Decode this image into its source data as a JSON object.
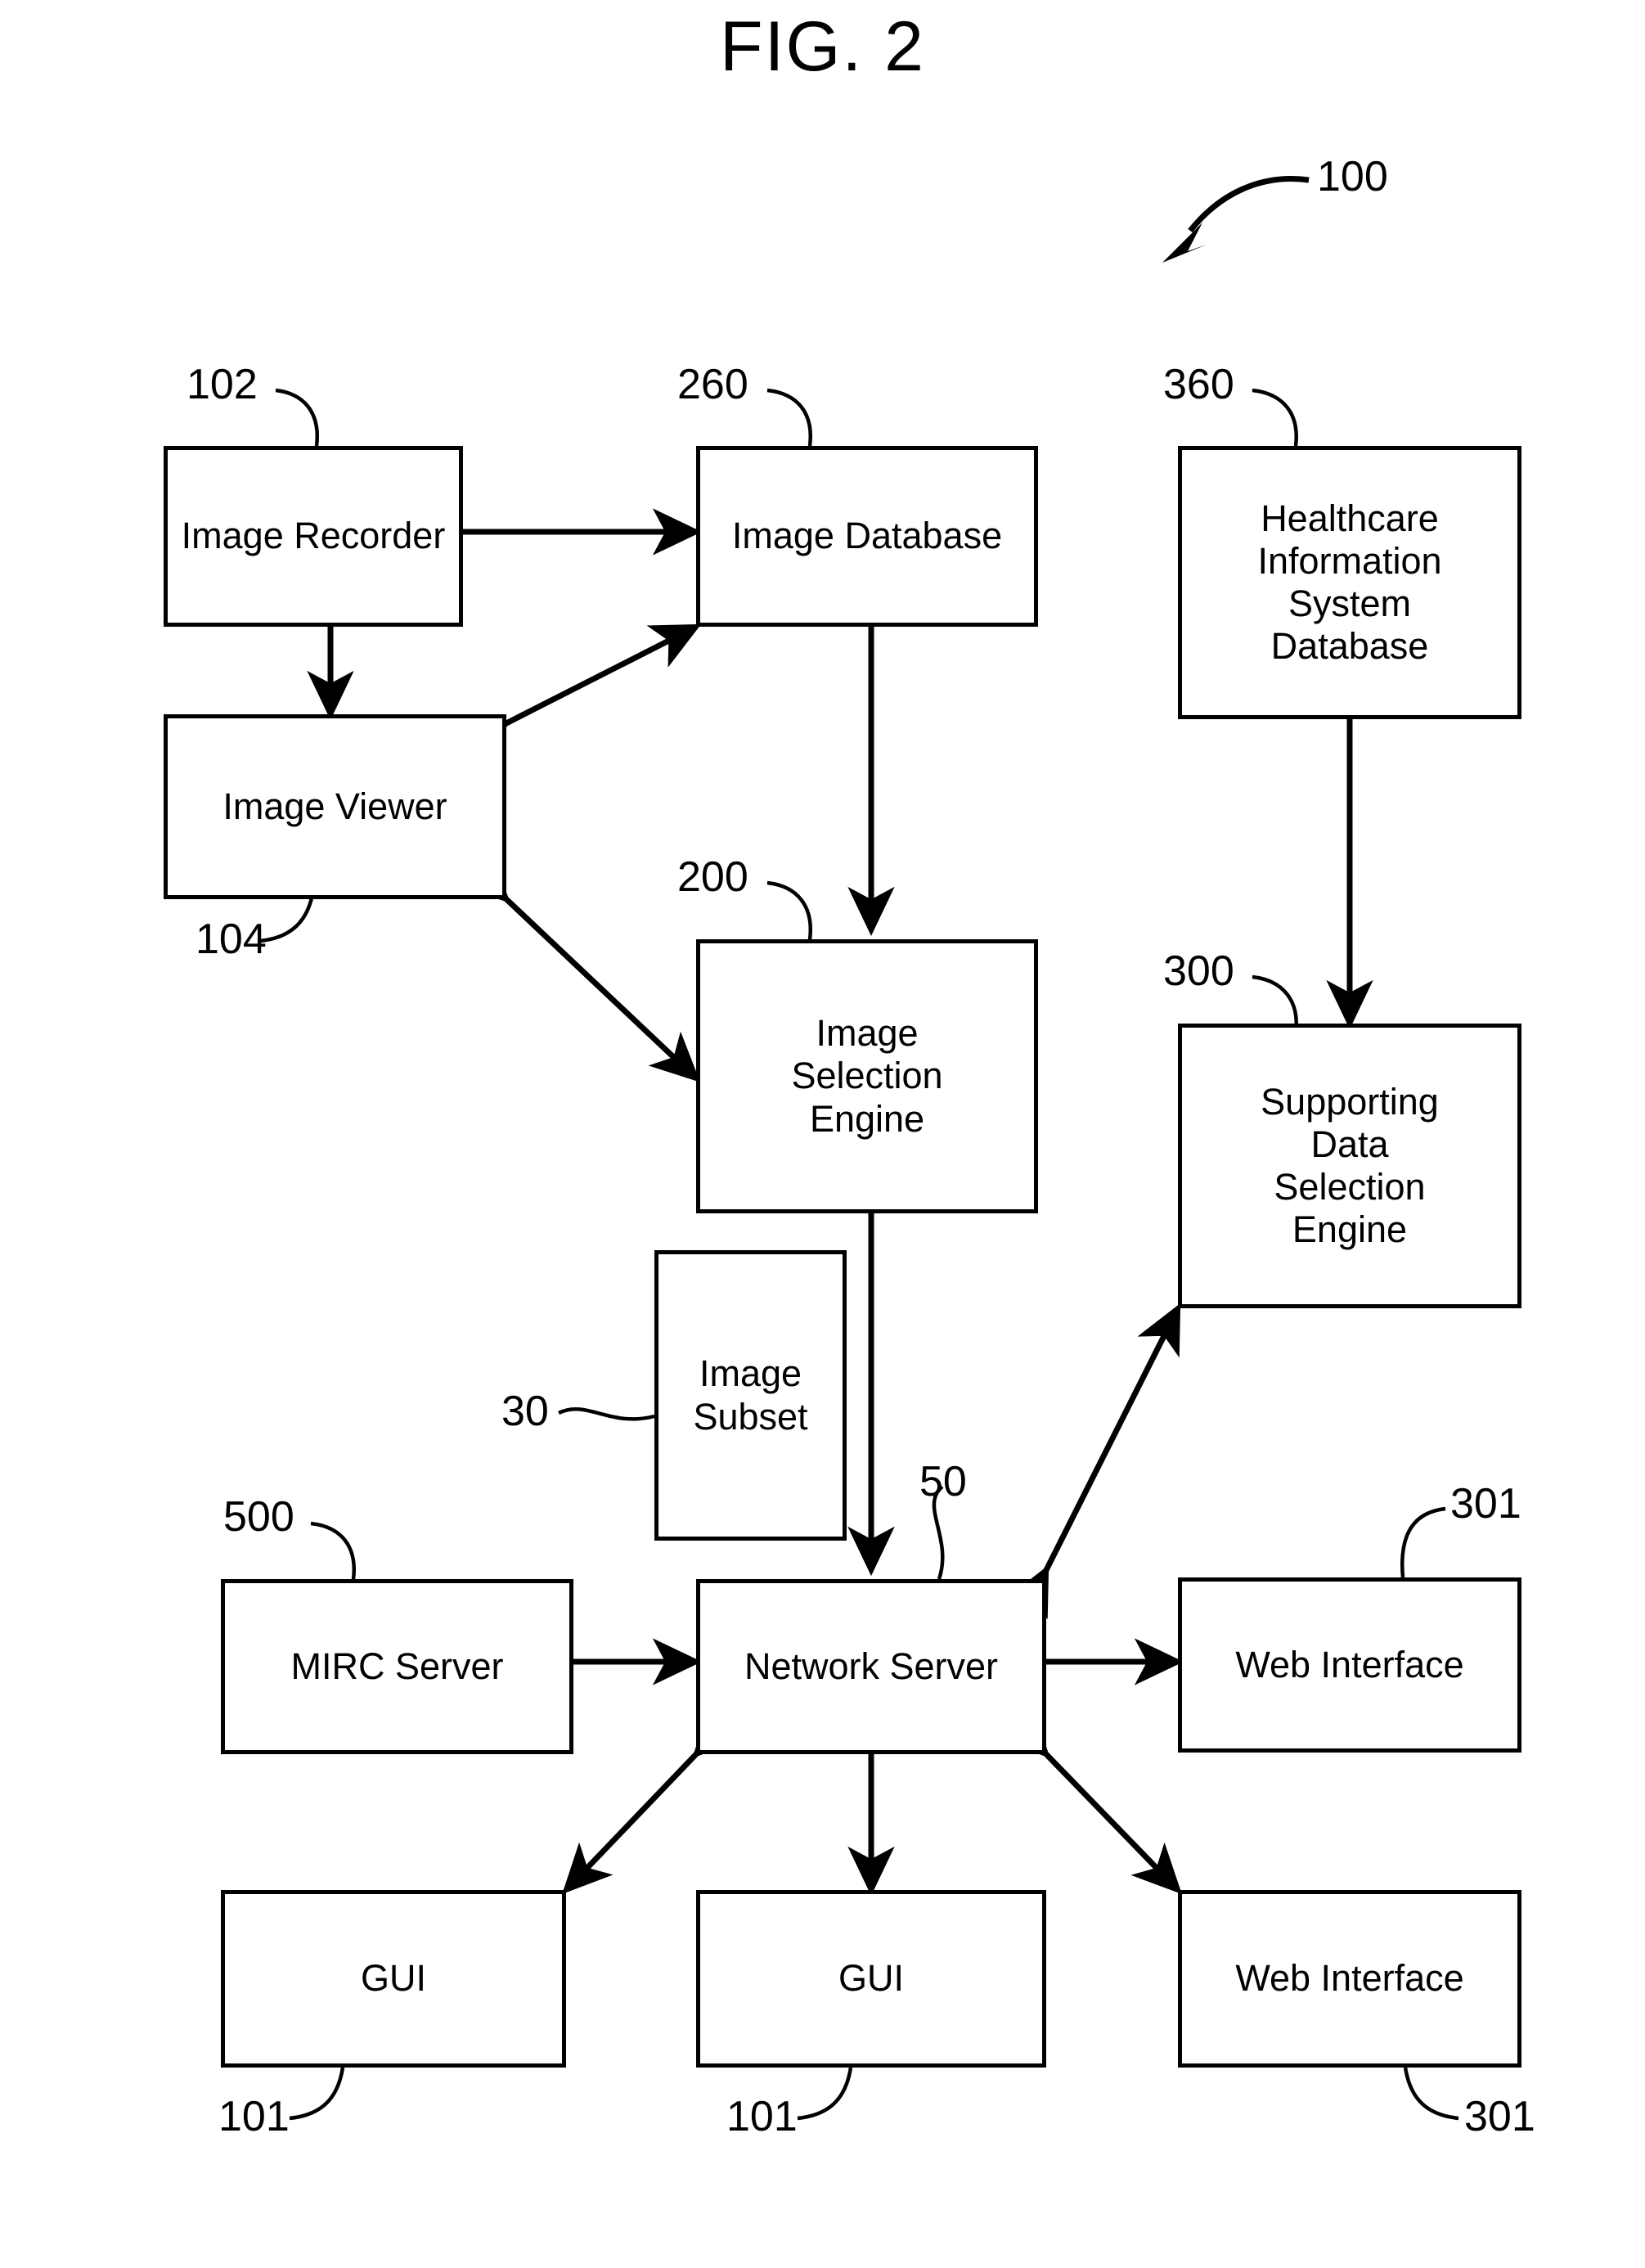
{
  "figure": {
    "title": "FIG. 2",
    "system_ref": "100"
  },
  "nodes": [
    {
      "id": "image-recorder",
      "label": "Image Recorder",
      "ref": "102"
    },
    {
      "id": "image-database",
      "label": "Image Database",
      "ref": "260"
    },
    {
      "id": "his-database",
      "label": "Healthcare\nInformation\nSystem\nDatabase",
      "ref": "360"
    },
    {
      "id": "image-viewer",
      "label": "Image Viewer",
      "ref": "104"
    },
    {
      "id": "image-selection",
      "label": "Image\nSelection\nEngine",
      "ref": "200"
    },
    {
      "id": "supporting-data",
      "label": "Supporting\nData\nSelection\nEngine",
      "ref": "300"
    },
    {
      "id": "image-subset",
      "label": "Image\nSubset",
      "ref": "30"
    },
    {
      "id": "mirc-server",
      "label": "MIRC Server",
      "ref": "500"
    },
    {
      "id": "network-server",
      "label": "Network Server",
      "ref": "50"
    },
    {
      "id": "web-interface-top",
      "label": "Web Interface",
      "ref": "301"
    },
    {
      "id": "gui-left",
      "label": "GUI",
      "ref": "101"
    },
    {
      "id": "gui-center",
      "label": "GUI",
      "ref": "101"
    },
    {
      "id": "web-interface-bot",
      "label": "Web Interface",
      "ref": "301"
    }
  ],
  "connections": [
    {
      "from": "image-recorder",
      "to": "image-database",
      "arrow": "both"
    },
    {
      "from": "image-recorder",
      "to": "image-viewer",
      "arrow": "both"
    },
    {
      "from": "image-viewer",
      "to": "image-database",
      "arrow": "both"
    },
    {
      "from": "image-database",
      "to": "image-selection",
      "arrow": "both"
    },
    {
      "from": "image-viewer",
      "to": "image-selection",
      "arrow": "both"
    },
    {
      "from": "his-database",
      "to": "supporting-data",
      "arrow": "both"
    },
    {
      "from": "image-selection",
      "to": "network-server",
      "arrow": "both"
    },
    {
      "from": "network-server",
      "to": "supporting-data",
      "arrow": "both"
    },
    {
      "from": "mirc-server",
      "to": "network-server",
      "arrow": "both"
    },
    {
      "from": "network-server",
      "to": "web-interface-top",
      "arrow": "both"
    },
    {
      "from": "network-server",
      "to": "gui-left",
      "arrow": "both"
    },
    {
      "from": "network-server",
      "to": "gui-center",
      "arrow": "both"
    },
    {
      "from": "network-server",
      "to": "web-interface-bot",
      "arrow": "both"
    }
  ]
}
